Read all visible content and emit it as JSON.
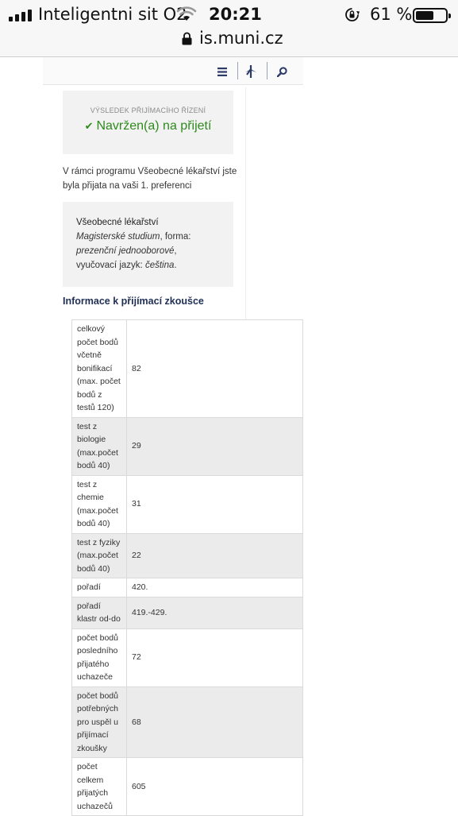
{
  "status_bar": {
    "carrier": "Inteligentni sit O2",
    "time": "20:21",
    "battery_percent": "61 %",
    "battery_level": 0.61
  },
  "browser": {
    "url": "is.muni.cz"
  },
  "nav": {
    "icons": [
      "menu-icon",
      "applications-icon",
      "search-icon"
    ]
  },
  "result": {
    "label": "VÝSLEDEK PŘIJÍMACÍHO ŘÍZENÍ",
    "check": "✔",
    "status": "Navržen(a) na přijetí"
  },
  "intro": {
    "text": "V rámci programu Všeobecné lékařství jste byla přijata na vaši 1. preferenci"
  },
  "program": {
    "name": "Všeobecné lékařství",
    "study_type": "Magisterské studium",
    "form_label": ", forma:",
    "form": "prezenční jednooborové",
    "comma": ",",
    "language_label": "vyučovací jazyk:",
    "language": "čeština",
    "period": "."
  },
  "exam": {
    "title": "Informace k přijímací zkoušce",
    "rows": [
      {
        "label": "celkový počet bodů včetně bonifikací (max. počet bodů z testů 120)",
        "value": "82"
      },
      {
        "label": "test z biologie (max.počet bodů 40)",
        "value": "29"
      },
      {
        "label": "test z chemie (max.počet bodů 40)",
        "value": "31"
      },
      {
        "label": "test z fyziky (max.počet bodů 40)",
        "value": "22"
      },
      {
        "label": "pořadí",
        "value": "420."
      },
      {
        "label": "pořadí klastr od-do",
        "value": "419.-429."
      },
      {
        "label": "počet bodů posledního přijatého uchazeče",
        "value": "72"
      },
      {
        "label": "počet bodů potřebných pro uspěl u přijímací zkoušky",
        "value": "68"
      },
      {
        "label": "počet celkem přijatých uchazečů",
        "value": "605"
      }
    ]
  }
}
